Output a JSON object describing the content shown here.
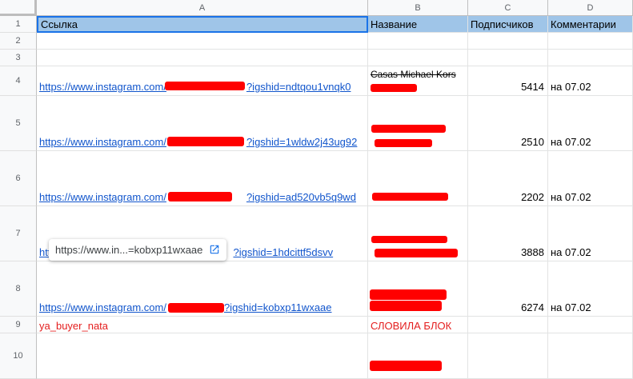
{
  "columns": [
    "A",
    "B",
    "C",
    "D"
  ],
  "header": {
    "link": "Ссылка",
    "name": "Название",
    "subs": "Подписчиков",
    "comments": "Комментарии"
  },
  "rows": [
    {
      "num": "1"
    },
    {
      "num": "2"
    },
    {
      "num": "3"
    },
    {
      "num": "4",
      "link_prefix": "https://www.instagram.com/",
      "link_suffix": "?igshid=ndtqou1vnqk0",
      "name": "Casas Michael Kors",
      "subs": "5414",
      "comment": "на 07.02"
    },
    {
      "num": "5",
      "link_prefix": "https://www.instagram.com/",
      "link_suffix": "?igshid=1wldw2j43ug92",
      "subs": "2510",
      "comment": "на 07.02"
    },
    {
      "num": "6",
      "link_prefix": "https://www.instagram.com/",
      "link_suffix": "?igshid=ad520vb5q9wd",
      "subs": "2202",
      "comment": "на 07.02"
    },
    {
      "num": "7",
      "link_prefix": "htt",
      "link_suffix": "?igshid=1hdcittf5dsvv",
      "subs": "3888",
      "comment": "на 07.02"
    },
    {
      "num": "8",
      "link_prefix": "https://www.instagram.com/",
      "link_suffix": "?igshid=kobxp11wxaae",
      "subs": "6274",
      "comment": "на 07.02"
    },
    {
      "num": "9",
      "link": "ya_buyer_nata",
      "name": "СЛОВИЛА БЛОК"
    },
    {
      "num": "10"
    }
  ],
  "tooltip": {
    "text": "https://www.in...=kobxp11wxaae",
    "icon": "open-in-new-icon"
  },
  "colors": {
    "header_bg": "#9fc5e8",
    "link": "#1155cc",
    "redaction": "#ff0000",
    "alert_text": "#e41e1e",
    "selection": "#1a73e8"
  }
}
